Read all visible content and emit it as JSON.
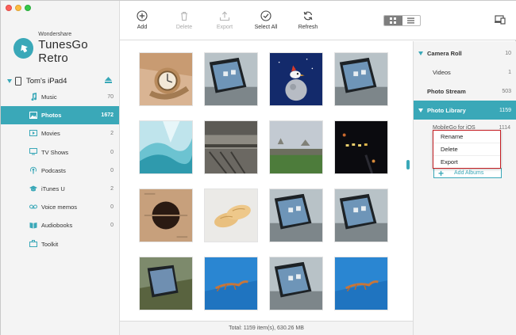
{
  "app": {
    "brand_small": "Wondershare",
    "brand_big": "TunesGo Retro",
    "accent": "#3aa8b8",
    "highlight": "#c41e23"
  },
  "device": {
    "name": "Tom's iPad4"
  },
  "sidebar": {
    "items": [
      {
        "label": "Music",
        "count": "70",
        "icon": "music-icon"
      },
      {
        "label": "Photos",
        "count": "1672",
        "icon": "photos-icon",
        "active": true
      },
      {
        "label": "Movies",
        "count": "2",
        "icon": "movies-icon"
      },
      {
        "label": "TV Shows",
        "count": "0",
        "icon": "tv-icon"
      },
      {
        "label": "Podcasts",
        "count": "0",
        "icon": "podcast-icon"
      },
      {
        "label": "iTunes U",
        "count": "2",
        "icon": "itunes-u-icon"
      },
      {
        "label": "Voice memos",
        "count": "0",
        "icon": "voice-memo-icon"
      },
      {
        "label": "Audiobooks",
        "count": "0",
        "icon": "audiobook-icon"
      },
      {
        "label": "Toolkit",
        "count": "",
        "icon": "toolkit-icon"
      }
    ]
  },
  "toolbar": {
    "add": "Add",
    "delete": "Delete",
    "export": "Export",
    "select_all": "Select All",
    "refresh": "Refresh"
  },
  "grid": {
    "photos": [
      "watch",
      "tablet-on-desk",
      "bird-on-globe",
      "tablet-on-desk",
      "aqua-abstract",
      "train-platform",
      "green-field",
      "night-lights",
      "dark-disc",
      "bread-rolls",
      "tablet-on-desk",
      "tablet-on-desk",
      "tablet-on-desk",
      "lizard-on-blue",
      "tablet-on-desk",
      "lizard-on-blue"
    ]
  },
  "status": {
    "text": "Total: 1159 item(s), 630.26 MB"
  },
  "albums": {
    "camera_roll": {
      "label": "Camera Roll",
      "count": "10"
    },
    "videos": {
      "label": "Videos",
      "count": "1"
    },
    "photo_stream": {
      "label": "Photo Stream",
      "count": "503"
    },
    "photo_library": {
      "label": "Photo Library",
      "count": "1159"
    },
    "mobilego": {
      "label": "MobileGo for iOS",
      "count": "1114"
    },
    "add_albums": "Add Albums"
  },
  "context_menu": {
    "items": [
      "Rename",
      "Delete",
      "Export"
    ]
  }
}
